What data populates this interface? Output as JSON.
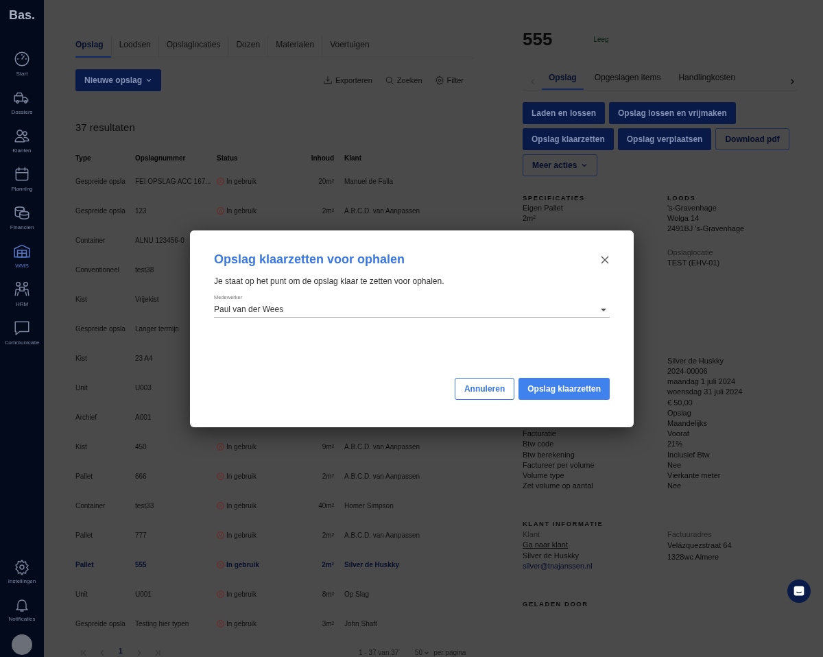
{
  "sidebar": {
    "logo": "Bas.",
    "items": [
      {
        "label": "Start",
        "kind": "dashboard",
        "selected": false
      },
      {
        "label": "Dossiers",
        "kind": "dossiers",
        "selected": false
      },
      {
        "label": "Klanten",
        "kind": "customers",
        "selected": false
      },
      {
        "label": "Planning",
        "kind": "planning",
        "selected": false
      },
      {
        "label": "Financien",
        "kind": "finance",
        "selected": false
      },
      {
        "label": "WMS",
        "kind": "wms",
        "selected": true
      },
      {
        "label": "HRM",
        "kind": "hrm",
        "selected": false
      },
      {
        "label": "Communicatie",
        "kind": "communication",
        "selected": false
      }
    ],
    "bottom_items": [
      {
        "label": "Instellingen",
        "kind": "settings"
      },
      {
        "label": "Notificaties",
        "kind": "notifications"
      }
    ]
  },
  "main": {
    "tabs": [
      {
        "label": "Opslag",
        "selected": true
      },
      {
        "label": "Loodsen",
        "selected": false
      },
      {
        "label": "Opslaglocaties",
        "selected": false
      },
      {
        "label": "Dozen",
        "selected": false
      },
      {
        "label": "Materialen",
        "selected": false
      },
      {
        "label": "Voertuigen",
        "selected": false
      }
    ],
    "new_button": "Nieuwe opslag",
    "toolbar": [
      {
        "label": "Exporteren",
        "kind": "export"
      },
      {
        "label": "Zoeken",
        "kind": "search"
      },
      {
        "label": "Filter",
        "kind": "filter"
      }
    ],
    "result_count": "37 resultaten",
    "columns": [
      "Type",
      "Opslagnummer",
      "Status",
      "Inhoud",
      "Klant"
    ],
    "rows": [
      {
        "type": "Gespreide opsla",
        "number": "FEI OPSLAG ACC 167...",
        "status": "In gebruik",
        "content": "20m²",
        "customer": "Manuel de Falla",
        "selected": false
      },
      {
        "type": "Gespreide opsla",
        "number": "123",
        "status": "In gebruik",
        "content": "2m²",
        "customer": "A.B.C.D. van Aanpassen",
        "selected": false
      },
      {
        "type": "Container",
        "number": "ALNU 123456-0",
        "selected": false
      },
      {
        "type": "Conventioneel",
        "number": "test38",
        "selected": false
      },
      {
        "type": "Kist",
        "number": "Vrijekist",
        "selected": false
      },
      {
        "type": "Gespreide opsla",
        "number": "Langer termijn",
        "selected": false
      },
      {
        "type": "Kist",
        "number": "23 A4",
        "selected": false
      },
      {
        "type": "Unit",
        "number": "U003",
        "selected": false
      },
      {
        "type": "Archief",
        "number": "A001",
        "selected": false
      },
      {
        "type": "Kist",
        "number": "450",
        "status": "In gebruik",
        "content": "9m²",
        "customer": "A.B.C.D. van Aanpassen",
        "selected": false
      },
      {
        "type": "Pallet",
        "number": "666",
        "status": "In gebruik",
        "content": "2m²",
        "customer": "A.B.C.D. van Aanpassen",
        "selected": false
      },
      {
        "type": "Container",
        "number": "test33",
        "status": "In gebruik",
        "content": "40m²",
        "customer": "Homer Simpson",
        "selected": false
      },
      {
        "type": "Pallet",
        "number": "777",
        "status": "In gebruik",
        "content": "2m²",
        "customer": "A.B.C.D. van Aanpassen",
        "selected": false
      },
      {
        "type": "Pallet",
        "number": "555",
        "status": "In gebruik",
        "content": "2m²",
        "customer": "Silver de Huskky",
        "selected": true
      },
      {
        "type": "Unit",
        "number": "U001",
        "status": "In gebruik",
        "content": "8m²",
        "customer": "Op Slag",
        "selected": false
      },
      {
        "type": "Gespreide opsla",
        "number": "Testing hier typen",
        "status": "In gebruik",
        "content": "3m²",
        "customer": "John Shaft",
        "selected": false
      }
    ],
    "pagination": {
      "page": "1",
      "range": "1 - 37 van 37",
      "per_page": "50",
      "per_page_label": "per pagina"
    }
  },
  "detail": {
    "title": "555",
    "status": "Leeg",
    "tabs": [
      {
        "label": "Opslag",
        "selected": true
      },
      {
        "label": "Opgeslagen items",
        "selected": false
      },
      {
        "label": "Handlingkosten",
        "selected": false
      }
    ],
    "actions": [
      {
        "label": "Laden en lossen",
        "kind": "primary"
      },
      {
        "label": "Opslag lossen en vrijmaken",
        "kind": "primary"
      },
      {
        "label": "Opslag klaarzetten",
        "kind": "primary"
      },
      {
        "label": "Opslag verplaatsen",
        "kind": "primary"
      },
      {
        "label": "Download pdf",
        "kind": "outline"
      },
      {
        "label": "Meer acties",
        "kind": "menu"
      }
    ],
    "specifications": {
      "heading": "SPECIFICATIES",
      "lines": [
        "Eigen Pallet",
        "2m²"
      ]
    },
    "warehouse": {
      "heading": "LOODS",
      "lines": [
        "'s-Gravenhage",
        "Wolga 14",
        "2491BJ 's-Gravenhage"
      ],
      "location_label": "Opslaglocatie",
      "location": "TEST (EHV-01)"
    },
    "fields": [
      {
        "value": "Silver de Huskky"
      },
      {
        "value": "2024-00006"
      },
      {
        "value": "maandag 1 juli 2024"
      },
      {
        "value": "woensdag 31 juli 2024"
      },
      {
        "value": "€ 50,00"
      },
      {
        "value": "Opslag"
      },
      {
        "value": "Maandelijks"
      },
      {
        "label": "Facturatie",
        "value": "Vooraf"
      },
      {
        "label": "Btw code",
        "value": "21%"
      },
      {
        "label": "Btw berekening",
        "value": "Inclusief Btw"
      },
      {
        "label": "Factureer per volume",
        "value": "Nee"
      },
      {
        "label": "Volume type",
        "value": "Vierkante meter"
      },
      {
        "label": "Zet volume op aantal",
        "value": "Nee"
      }
    ],
    "customer": {
      "heading": "KLANT INFORMATIE",
      "label": "Klant",
      "link": "Ga naar klant",
      "name": "Silver de Huskky",
      "email": "silver@tnajanssen.nl",
      "address_label": "Factuuradres",
      "address": [
        "Velázquezstraat 64",
        "1328wc Almere"
      ]
    },
    "loaded_by": {
      "heading": "GELADEN DOOR"
    }
  },
  "dialog": {
    "title": "Opslag klaarzetten voor ophalen",
    "message": "Je staat op het punt om de opslag klaar te zetten voor ophalen.",
    "field": {
      "label": "Medewerker",
      "value": "Paul van der Wees"
    },
    "buttons": [
      {
        "label": "Annuleren",
        "kind": "secondary"
      },
      {
        "label": "Opslag klaarzetten",
        "kind": "primary"
      }
    ]
  }
}
